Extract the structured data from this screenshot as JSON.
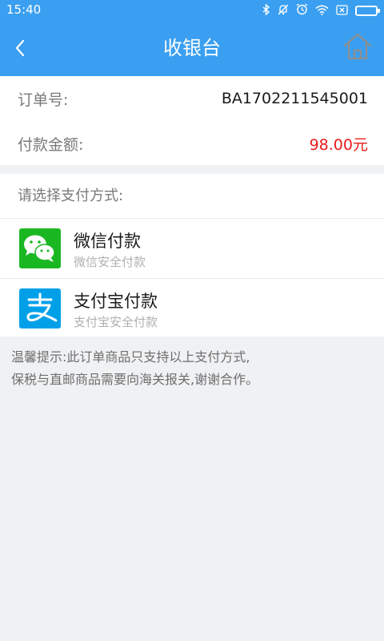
{
  "status_bar": {
    "time": "15:40"
  },
  "nav": {
    "title": "收银台",
    "back_icon": "chevron-left-icon",
    "home_icon": "home-icon",
    "background": "#3a9ff0"
  },
  "order": {
    "number_label": "订单号:",
    "number_value": "BA1702211545001",
    "amount_label": "付款金额:",
    "amount_value": "98.00元",
    "amount_color": "#e81d1d"
  },
  "payment": {
    "header": "请选择支付方式:",
    "methods": [
      {
        "title": "微信付款",
        "subtitle": "微信安全付款",
        "icon": "wechat-pay-icon",
        "color": "#1bb723"
      },
      {
        "title": "支付宝付款",
        "subtitle": "支付宝安全付款",
        "icon": "alipay-icon",
        "color": "#00a0e9"
      }
    ]
  },
  "tip": {
    "line1": "温馨提示:此订单商品只支持以上支付方式,",
    "line2": "保税与直邮商品需要向海关报关,谢谢合作。"
  }
}
